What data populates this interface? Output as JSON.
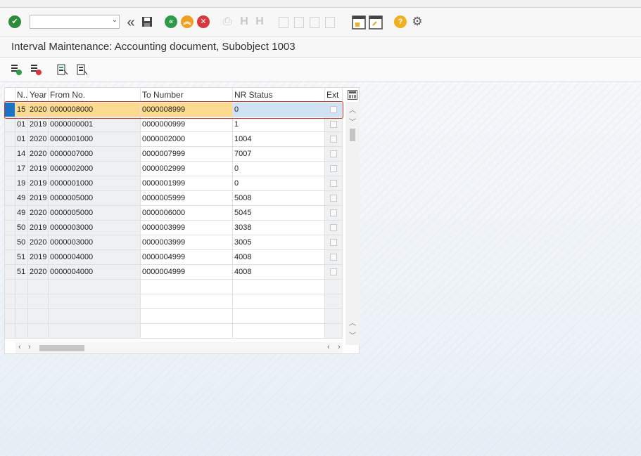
{
  "toolbar": {
    "command_placeholder": "",
    "icons": [
      "enter-check-icon",
      "back-double-icon",
      "save-icon",
      "back-icon",
      "exit-icon",
      "cancel-icon",
      "print-icon",
      "find-icon",
      "find-next-icon",
      "first-page-icon",
      "prev-page-icon",
      "next-page-icon",
      "last-page-icon",
      "create-session-icon",
      "shortcut-icon",
      "help-icon",
      "settings-icon"
    ]
  },
  "title": "Interval Maintenance: Accounting document, Subobject 1003",
  "app_toolbar": {
    "icons": [
      "insert-interval-icon",
      "delete-interval-icon",
      "change-status-icon",
      "detail-icon"
    ]
  },
  "table": {
    "headers": {
      "no": "N..",
      "year": "Year",
      "from": "From No.",
      "to": "To Number",
      "status": "NR Status",
      "ext": "Ext"
    },
    "rows": [
      {
        "no": "15",
        "year": "2020",
        "from": "0000008000",
        "to": "0000008999",
        "status": "0"
      },
      {
        "no": "01",
        "year": "2019",
        "from": "0000000001",
        "to": "0000000999",
        "status": "1"
      },
      {
        "no": "01",
        "year": "2020",
        "from": "0000001000",
        "to": "0000002000",
        "status": "1004"
      },
      {
        "no": "14",
        "year": "2020",
        "from": "0000007000",
        "to": "0000007999",
        "status": "7007"
      },
      {
        "no": "17",
        "year": "2019",
        "from": "0000002000",
        "to": "0000002999",
        "status": "0"
      },
      {
        "no": "19",
        "year": "2019",
        "from": "0000001000",
        "to": "0000001999",
        "status": "0"
      },
      {
        "no": "49",
        "year": "2019",
        "from": "0000005000",
        "to": "0000005999",
        "status": "5008"
      },
      {
        "no": "49",
        "year": "2020",
        "from": "0000005000",
        "to": "0000006000",
        "status": "5045"
      },
      {
        "no": "50",
        "year": "2019",
        "from": "0000003000",
        "to": "0000003999",
        "status": "3038"
      },
      {
        "no": "50",
        "year": "2020",
        "from": "0000003000",
        "to": "0000003999",
        "status": "3005"
      },
      {
        "no": "51",
        "year": "2019",
        "from": "0000004000",
        "to": "0000004999",
        "status": "4008"
      },
      {
        "no": "51",
        "year": "2020",
        "from": "0000004000",
        "to": "0000004999",
        "status": "4008"
      }
    ]
  },
  "colors": {
    "selected_row": "#fbd98f",
    "editing_cell": "#cfe3f5",
    "highlight_border": "#c0392b",
    "check_green": "#2e8b3a",
    "nav_green": "#2e9b4a",
    "nav_orange": "#f0a020",
    "nav_red": "#d9363e",
    "help_yellow": "#f0b020"
  }
}
